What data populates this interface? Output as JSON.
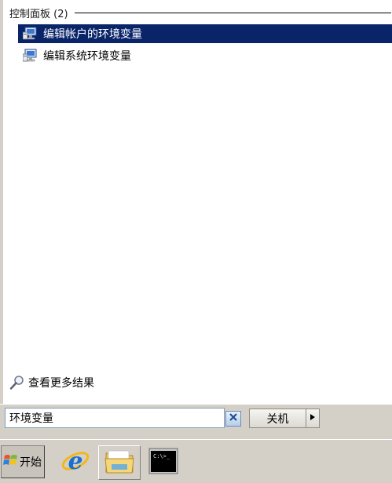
{
  "results": {
    "section_title": "控制面板 (2)",
    "items": [
      {
        "label": "编辑帐户的环境变量",
        "icon": "system-properties-icon",
        "selected": true
      },
      {
        "label": "编辑系统环境变量",
        "icon": "system-properties-icon",
        "selected": false
      }
    ],
    "more_results_label": "查看更多结果"
  },
  "search": {
    "value": "环境变量",
    "clear_icon": "clear-x-icon"
  },
  "shutdown": {
    "label": "关机",
    "arrow_icon": "triangle-right-icon"
  },
  "taskbar": {
    "start_label": "开始",
    "pinned": [
      {
        "name": "internet-explorer-icon"
      },
      {
        "name": "folder-icon"
      },
      {
        "name": "command-prompt-icon"
      }
    ]
  },
  "colors": {
    "selection": "#0a246a",
    "chrome": "#d4d0c8"
  }
}
